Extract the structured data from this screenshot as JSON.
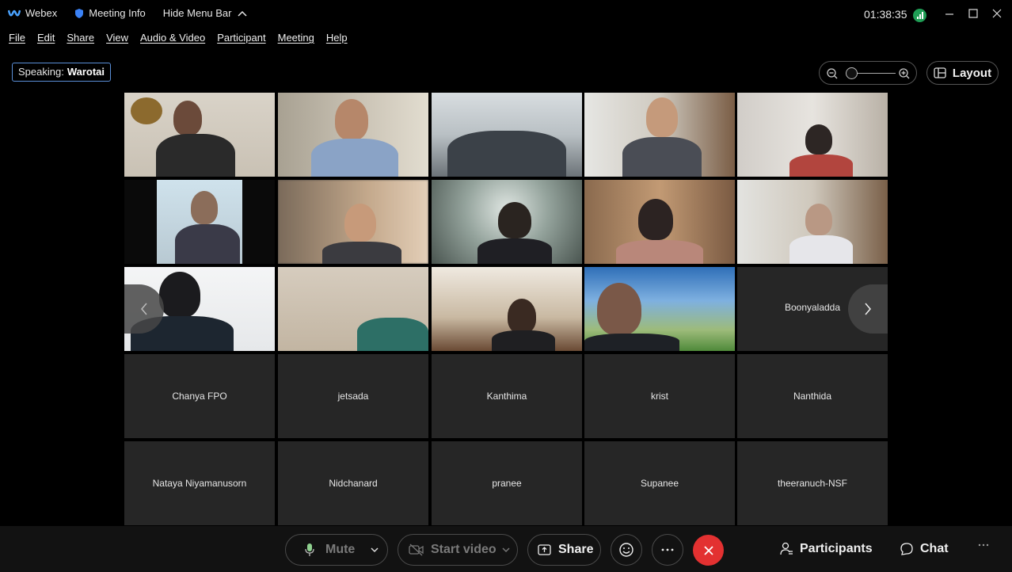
{
  "titlebar": {
    "app_name": "Webex",
    "meeting_info": "Meeting Info",
    "hide_menu": "Hide Menu Bar",
    "clock": "01:38:35"
  },
  "menu": [
    "File",
    "Edit",
    "Share",
    "View",
    "Audio & Video",
    "Participant",
    "Meeting",
    "Help"
  ],
  "speaking": {
    "label": "Speaking:",
    "name": "Warotai"
  },
  "layout_label": "Layout",
  "name_tiles": {
    "boonyaladda": "Boonyaladda",
    "row4": [
      "Chanya FPO",
      "jetsada",
      "Kanthima",
      "krist",
      "Nanthida"
    ],
    "row5": [
      "Nataya Niyamanusorn",
      "Nidchanard",
      "pranee",
      "Supanee",
      "theeranuch-NSF"
    ]
  },
  "controls": {
    "mute": "Mute",
    "start_video": "Start video",
    "share": "Share",
    "participants": "Participants",
    "chat": "Chat"
  },
  "colors": {
    "accent_blue": "#5a8fd8",
    "end_red": "#e33131",
    "signal_green": "#1f9d55"
  }
}
